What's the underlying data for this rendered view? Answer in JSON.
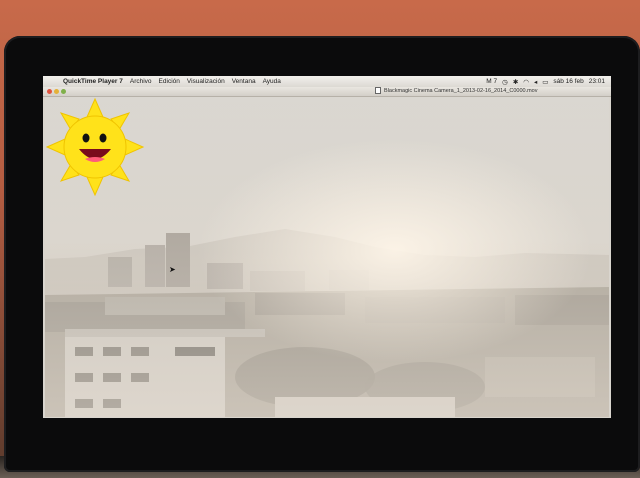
{
  "menubar": {
    "app_name": "QuickTime Player 7",
    "menus": [
      "Archivo",
      "Edición",
      "Visualización",
      "Ventana",
      "Ayuda"
    ],
    "status": {
      "indicator": "M 7",
      "date": "sáb 16 feb",
      "time": "23:01"
    }
  },
  "window": {
    "title": "Blackmagic Cinema Camera_1_2013-02-16_2014_C0000.mov"
  },
  "colors": {
    "close": "#e0533f",
    "minimize": "#e4b138",
    "zoom": "#7fb04a",
    "sun": "#ffe21a"
  }
}
